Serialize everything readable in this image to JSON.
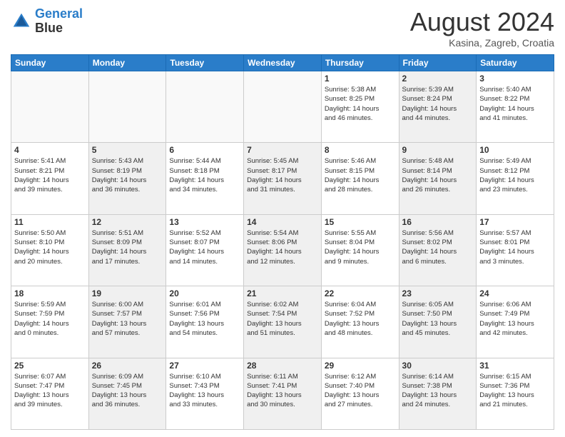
{
  "header": {
    "logo_line1": "General",
    "logo_line2": "Blue",
    "month": "August 2024",
    "location": "Kasina, Zagreb, Croatia"
  },
  "days_of_week": [
    "Sunday",
    "Monday",
    "Tuesday",
    "Wednesday",
    "Thursday",
    "Friday",
    "Saturday"
  ],
  "weeks": [
    [
      {
        "day": "",
        "info": "",
        "shaded": false,
        "empty": true
      },
      {
        "day": "",
        "info": "",
        "shaded": false,
        "empty": true
      },
      {
        "day": "",
        "info": "",
        "shaded": false,
        "empty": true
      },
      {
        "day": "",
        "info": "",
        "shaded": false,
        "empty": true
      },
      {
        "day": "1",
        "info": "Sunrise: 5:38 AM\nSunset: 8:25 PM\nDaylight: 14 hours\nand 46 minutes.",
        "shaded": false,
        "empty": false
      },
      {
        "day": "2",
        "info": "Sunrise: 5:39 AM\nSunset: 8:24 PM\nDaylight: 14 hours\nand 44 minutes.",
        "shaded": true,
        "empty": false
      },
      {
        "day": "3",
        "info": "Sunrise: 5:40 AM\nSunset: 8:22 PM\nDaylight: 14 hours\nand 41 minutes.",
        "shaded": false,
        "empty": false
      }
    ],
    [
      {
        "day": "4",
        "info": "Sunrise: 5:41 AM\nSunset: 8:21 PM\nDaylight: 14 hours\nand 39 minutes.",
        "shaded": false,
        "empty": false
      },
      {
        "day": "5",
        "info": "Sunrise: 5:43 AM\nSunset: 8:19 PM\nDaylight: 14 hours\nand 36 minutes.",
        "shaded": true,
        "empty": false
      },
      {
        "day": "6",
        "info": "Sunrise: 5:44 AM\nSunset: 8:18 PM\nDaylight: 14 hours\nand 34 minutes.",
        "shaded": false,
        "empty": false
      },
      {
        "day": "7",
        "info": "Sunrise: 5:45 AM\nSunset: 8:17 PM\nDaylight: 14 hours\nand 31 minutes.",
        "shaded": true,
        "empty": false
      },
      {
        "day": "8",
        "info": "Sunrise: 5:46 AM\nSunset: 8:15 PM\nDaylight: 14 hours\nand 28 minutes.",
        "shaded": false,
        "empty": false
      },
      {
        "day": "9",
        "info": "Sunrise: 5:48 AM\nSunset: 8:14 PM\nDaylight: 14 hours\nand 26 minutes.",
        "shaded": true,
        "empty": false
      },
      {
        "day": "10",
        "info": "Sunrise: 5:49 AM\nSunset: 8:12 PM\nDaylight: 14 hours\nand 23 minutes.",
        "shaded": false,
        "empty": false
      }
    ],
    [
      {
        "day": "11",
        "info": "Sunrise: 5:50 AM\nSunset: 8:10 PM\nDaylight: 14 hours\nand 20 minutes.",
        "shaded": false,
        "empty": false
      },
      {
        "day": "12",
        "info": "Sunrise: 5:51 AM\nSunset: 8:09 PM\nDaylight: 14 hours\nand 17 minutes.",
        "shaded": true,
        "empty": false
      },
      {
        "day": "13",
        "info": "Sunrise: 5:52 AM\nSunset: 8:07 PM\nDaylight: 14 hours\nand 14 minutes.",
        "shaded": false,
        "empty": false
      },
      {
        "day": "14",
        "info": "Sunrise: 5:54 AM\nSunset: 8:06 PM\nDaylight: 14 hours\nand 12 minutes.",
        "shaded": true,
        "empty": false
      },
      {
        "day": "15",
        "info": "Sunrise: 5:55 AM\nSunset: 8:04 PM\nDaylight: 14 hours\nand 9 minutes.",
        "shaded": false,
        "empty": false
      },
      {
        "day": "16",
        "info": "Sunrise: 5:56 AM\nSunset: 8:02 PM\nDaylight: 14 hours\nand 6 minutes.",
        "shaded": true,
        "empty": false
      },
      {
        "day": "17",
        "info": "Sunrise: 5:57 AM\nSunset: 8:01 PM\nDaylight: 14 hours\nand 3 minutes.",
        "shaded": false,
        "empty": false
      }
    ],
    [
      {
        "day": "18",
        "info": "Sunrise: 5:59 AM\nSunset: 7:59 PM\nDaylight: 14 hours\nand 0 minutes.",
        "shaded": false,
        "empty": false
      },
      {
        "day": "19",
        "info": "Sunrise: 6:00 AM\nSunset: 7:57 PM\nDaylight: 13 hours\nand 57 minutes.",
        "shaded": true,
        "empty": false
      },
      {
        "day": "20",
        "info": "Sunrise: 6:01 AM\nSunset: 7:56 PM\nDaylight: 13 hours\nand 54 minutes.",
        "shaded": false,
        "empty": false
      },
      {
        "day": "21",
        "info": "Sunrise: 6:02 AM\nSunset: 7:54 PM\nDaylight: 13 hours\nand 51 minutes.",
        "shaded": true,
        "empty": false
      },
      {
        "day": "22",
        "info": "Sunrise: 6:04 AM\nSunset: 7:52 PM\nDaylight: 13 hours\nand 48 minutes.",
        "shaded": false,
        "empty": false
      },
      {
        "day": "23",
        "info": "Sunrise: 6:05 AM\nSunset: 7:50 PM\nDaylight: 13 hours\nand 45 minutes.",
        "shaded": true,
        "empty": false
      },
      {
        "day": "24",
        "info": "Sunrise: 6:06 AM\nSunset: 7:49 PM\nDaylight: 13 hours\nand 42 minutes.",
        "shaded": false,
        "empty": false
      }
    ],
    [
      {
        "day": "25",
        "info": "Sunrise: 6:07 AM\nSunset: 7:47 PM\nDaylight: 13 hours\nand 39 minutes.",
        "shaded": false,
        "empty": false
      },
      {
        "day": "26",
        "info": "Sunrise: 6:09 AM\nSunset: 7:45 PM\nDaylight: 13 hours\nand 36 minutes.",
        "shaded": true,
        "empty": false
      },
      {
        "day": "27",
        "info": "Sunrise: 6:10 AM\nSunset: 7:43 PM\nDaylight: 13 hours\nand 33 minutes.",
        "shaded": false,
        "empty": false
      },
      {
        "day": "28",
        "info": "Sunrise: 6:11 AM\nSunset: 7:41 PM\nDaylight: 13 hours\nand 30 minutes.",
        "shaded": true,
        "empty": false
      },
      {
        "day": "29",
        "info": "Sunrise: 6:12 AM\nSunset: 7:40 PM\nDaylight: 13 hours\nand 27 minutes.",
        "shaded": false,
        "empty": false
      },
      {
        "day": "30",
        "info": "Sunrise: 6:14 AM\nSunset: 7:38 PM\nDaylight: 13 hours\nand 24 minutes.",
        "shaded": true,
        "empty": false
      },
      {
        "day": "31",
        "info": "Sunrise: 6:15 AM\nSunset: 7:36 PM\nDaylight: 13 hours\nand 21 minutes.",
        "shaded": false,
        "empty": false
      }
    ]
  ]
}
